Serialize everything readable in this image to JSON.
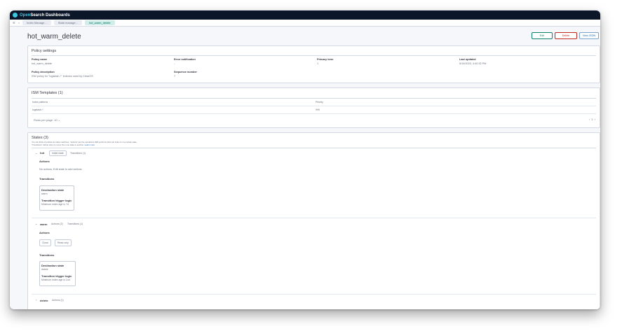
{
  "app": {
    "brand_a": "Open",
    "brand_b": "Search Dashboards"
  },
  "breadcrumbs": [
    "Index Manage...",
    "State manage...",
    "hot_warm_delete"
  ],
  "page": {
    "title": "hot_warm_delete",
    "edit": "Edit",
    "delete": "Delete",
    "view_json": "View JSON"
  },
  "policy_settings": {
    "title": "Policy settings",
    "fields": [
      {
        "label": "Policy name",
        "value": "hot_warm_delete"
      },
      {
        "label": "Error notification",
        "value": "-"
      },
      {
        "label": "Primary term",
        "value": "1"
      },
      {
        "label": "Last updated",
        "value": "5/19/2023, 4:40:32 PM"
      },
      {
        "label": "Policy description",
        "value": "ISM policy for \"logstash-*\" indexes used by ClearOS"
      },
      {
        "label": "Sequence number",
        "value": "7"
      }
    ]
  },
  "ism_templates": {
    "title": "ISM Templates (1)",
    "col_index": "Index patterns",
    "col_priority": "Priority",
    "row_index": "logstash-*",
    "row_priority": "999",
    "rows_per_page": "Rows per page: 10",
    "page_num": "1"
  },
  "states": {
    "title": "States (3)",
    "desc1": "You can think of policies as state machines. \"Actions\" are the operations ISM performs when an index is in a certain state.",
    "desc2": "\"Transitions\" define when to move from one state to another.",
    "learn_more": "Learn more",
    "items": [
      {
        "name": "hot",
        "badge": "Initial state",
        "counts": "Transitions (1)",
        "actions_label": "Actions",
        "actions_empty": "No actions. Edit state to add actions.",
        "transitions_label": "Transitions",
        "dest_label": "Destination state",
        "dest_value": "warm",
        "logic_label": "Transition trigger logic",
        "logic_value": "Minimum index age is 7d"
      },
      {
        "name": "warm",
        "actions_count": "Actions (2)",
        "trans_count": "Transitions (1)",
        "actions_label": "Actions",
        "action1": "Close",
        "action2": "Read only",
        "transitions_label": "Transitions",
        "dest_label": "Destination state",
        "dest_value": "delete",
        "logic_label": "Transition trigger logic",
        "logic_value": "Minimum index age is 14d"
      },
      {
        "name": "delete",
        "actions_count": "Actions (1)"
      }
    ]
  },
  "colors": {
    "topbar": "#0b1628",
    "accent": "#0c7f6f",
    "danger": "#bd271e"
  }
}
